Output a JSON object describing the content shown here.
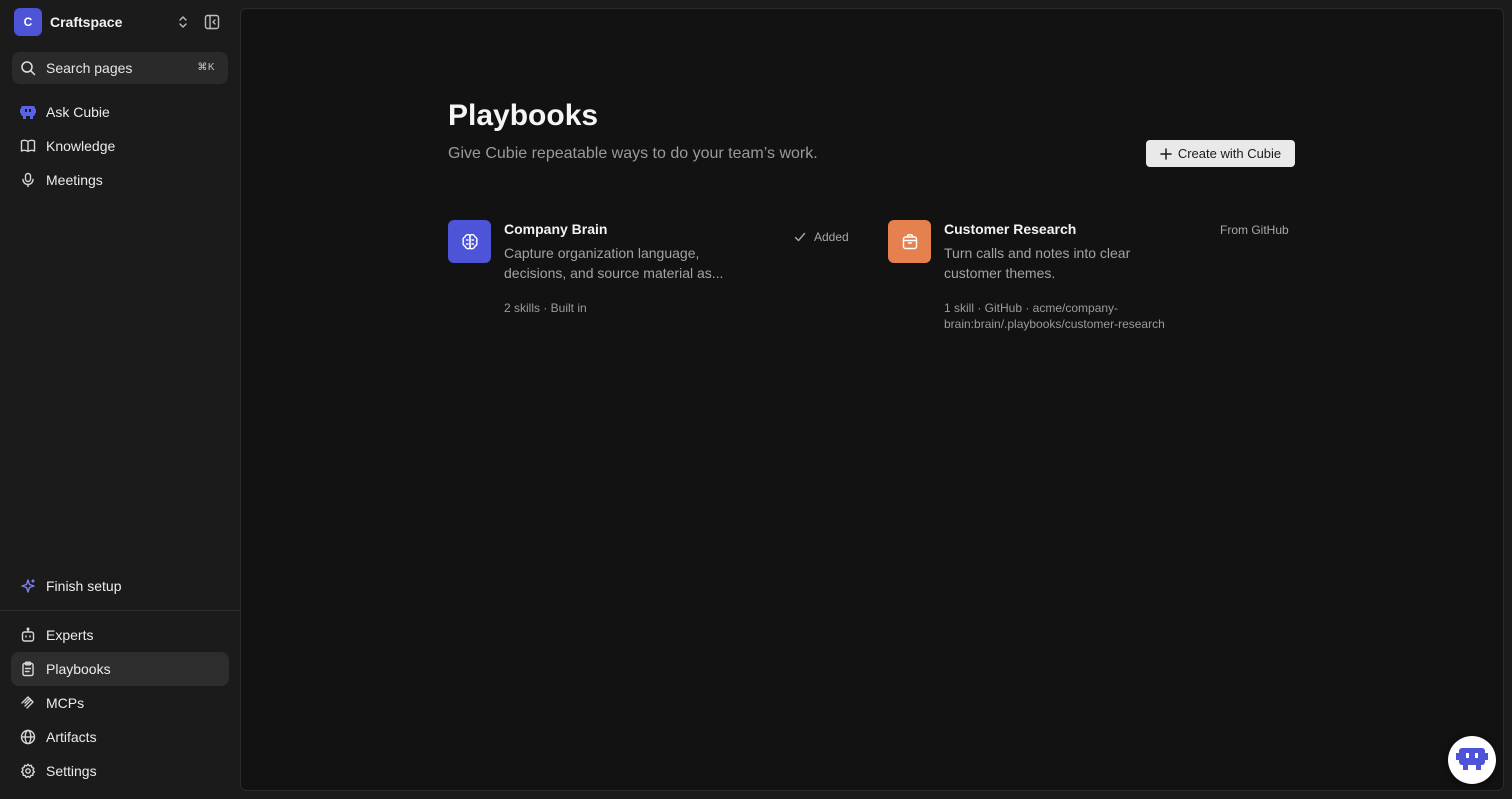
{
  "workspace": {
    "initial": "C",
    "name": "Craftspace"
  },
  "search": {
    "label": "Search pages",
    "shortcut": "⌘K"
  },
  "nav_top": [
    {
      "label": "Ask Cubie",
      "icon": "cubie-icon"
    },
    {
      "label": "Knowledge",
      "icon": "book-icon"
    },
    {
      "label": "Meetings",
      "icon": "microphone-icon"
    }
  ],
  "finish_setup": {
    "label": "Finish setup",
    "icon": "sparkle-icon"
  },
  "nav_bottom": [
    {
      "label": "Experts",
      "icon": "robot-icon"
    },
    {
      "label": "Playbooks",
      "icon": "clipboard-icon",
      "active": true
    },
    {
      "label": "MCPs",
      "icon": "mcp-icon"
    },
    {
      "label": "Artifacts",
      "icon": "globe-icon"
    },
    {
      "label": "Settings",
      "icon": "gear-icon"
    }
  ],
  "page": {
    "title": "Playbooks",
    "subtitle": "Give Cubie repeatable ways to do your team’s work.",
    "create_label": "Create with Cubie"
  },
  "cards": [
    {
      "title": "Company Brain",
      "description_line1": "Capture organization language,",
      "description_line2": "decisions, and source material as...",
      "meta_line1": "2 skills · Built in",
      "status": "Added",
      "icon": "brain-icon",
      "icon_color": "#4d54d8"
    },
    {
      "title": "Customer Research",
      "description_line1": "Turn calls and notes into clear",
      "description_line2": "customer themes.",
      "meta_line1": "1 skill · GitHub · acme/company-",
      "meta_line2": "brain:brain/.playbooks/customer-research",
      "status": "From GitHub",
      "icon": "package-icon",
      "icon_color": "#e5804f"
    }
  ],
  "colors": {
    "accent": "#4d54d8",
    "orange": "#e5804f",
    "sidebar_bg": "#1b1b1b",
    "main_bg": "#121212"
  }
}
